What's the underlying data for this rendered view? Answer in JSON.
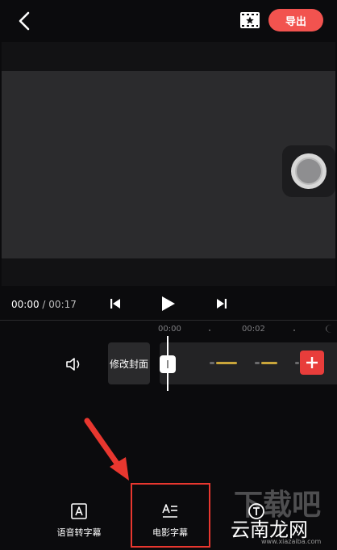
{
  "header": {
    "back_icon": "chevron-left-icon",
    "template_icon": "film-star-icon",
    "export_label": "导出"
  },
  "preview": {
    "float_button_icon": "record-icon"
  },
  "playback": {
    "current_time": "00:00",
    "separator": "/",
    "total_time": "00:17",
    "prev_icon": "skip-back-icon",
    "play_icon": "play-icon",
    "next_icon": "skip-forward-icon"
  },
  "timeline": {
    "ticks": [
      "00:00",
      "00:02"
    ],
    "volume_icon": "volume-icon",
    "cover_label": "修改封面",
    "add_icon": "plus-icon"
  },
  "toolbar": {
    "items": [
      {
        "label": "语音转字幕",
        "icon": "auto-caption-icon"
      },
      {
        "label": "电影字幕",
        "icon": "movie-subtitle-icon"
      },
      {
        "label": "",
        "icon": "text-icon"
      }
    ]
  },
  "watermark": {
    "main": "下载吧",
    "sub": "云南龙网",
    "url": "www.xiazaiba.com"
  },
  "colors": {
    "accent": "#f2534f",
    "add_button": "#e83d3b",
    "highlight": "#e8372f",
    "background": "#0b0b0d"
  }
}
